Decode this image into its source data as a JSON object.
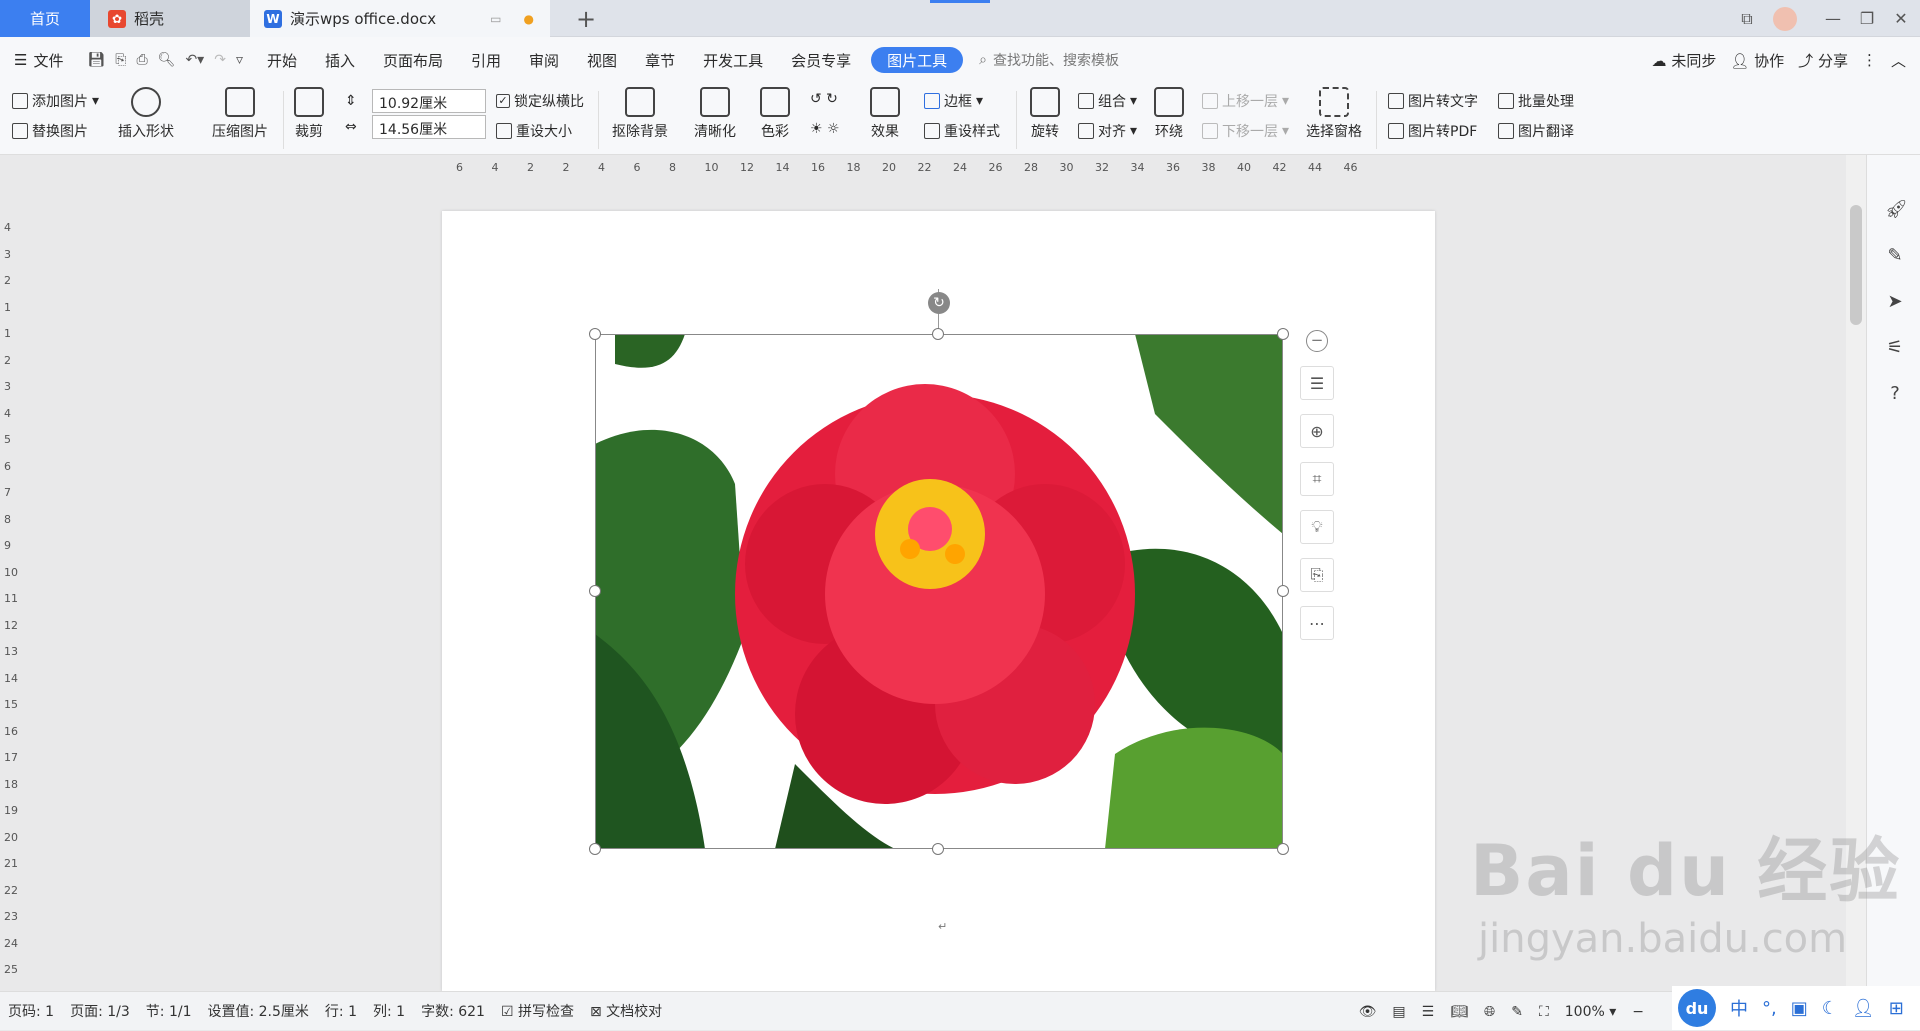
{
  "tabs": {
    "home": "首页",
    "daoke": "稻壳",
    "doc": "演示wps office.docx"
  },
  "menu": {
    "file": "文件",
    "items": [
      "开始",
      "插入",
      "页面布局",
      "引用",
      "审阅",
      "视图",
      "章节",
      "开发工具",
      "会员专享"
    ],
    "active": "图片工具",
    "search_placeholder": "查找功能、搜索模板",
    "sync": "未同步",
    "collab": "协作",
    "share": "分享"
  },
  "ribbon": {
    "add_picture": "添加图片",
    "replace_picture": "替换图片",
    "insert_shape": "插入形状",
    "compress": "压缩图片",
    "crop": "裁剪",
    "height": "10.92厘米",
    "width": "14.56厘米",
    "lock_ratio": "锁定纵横比",
    "reset_size": "重设大小",
    "remove_bg": "抠除背景",
    "sharpen": "清晰化",
    "color": "色彩",
    "effect": "效果",
    "border": "边框",
    "reset_style": "重设样式",
    "rotate": "旋转",
    "group": "组合",
    "align": "对齐",
    "wrap": "环绕",
    "bring_forward": "上移一层",
    "send_backward": "下移一层",
    "selection_pane": "选择窗格",
    "pic_to_text": "图片转文字",
    "pic_to_pdf": "图片转PDF",
    "batch": "批量处理",
    "pic_translate": "图片翻译"
  },
  "ruler": {
    "h_ticks": [
      "6",
      "4",
      "2",
      "2",
      "4",
      "6",
      "8",
      "10",
      "12",
      "14",
      "16",
      "18",
      "20",
      "22",
      "24",
      "26",
      "28",
      "30",
      "32",
      "34",
      "36",
      "38",
      "40",
      "42",
      "44",
      "46"
    ],
    "v_ticks": [
      "4",
      "3",
      "2",
      "1",
      "1",
      "2",
      "3",
      "4",
      "5",
      "6",
      "7",
      "8",
      "9",
      "10",
      "11",
      "12",
      "13",
      "14",
      "15",
      "16",
      "17",
      "18",
      "19",
      "20",
      "21",
      "22",
      "23",
      "24",
      "25"
    ]
  },
  "status": {
    "page_code": "页码: 1",
    "page": "页面: 1/3",
    "section": "节: 1/1",
    "setting": "设置值: 2.5厘米",
    "row": "行: 1",
    "col": "列: 1",
    "words": "字数: 621",
    "spell": "拼写检查",
    "proof": "文档校对",
    "zoom": "100%"
  },
  "watermark": {
    "brand": "Bai du 经验",
    "url": "jingyan.baidu.com"
  },
  "ime": {
    "logo": "du",
    "lang": "中"
  }
}
